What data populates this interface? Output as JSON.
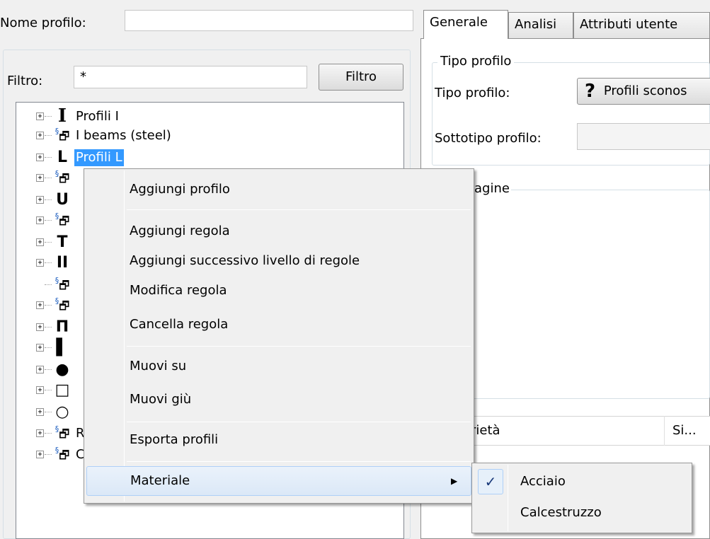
{
  "profile_name": {
    "label": "Nome profilo:",
    "value": ""
  },
  "filter": {
    "label": "Filtro:",
    "value": "*",
    "button": "Filtro"
  },
  "tree": {
    "items": [
      {
        "label": "Profili I",
        "icon": "i-beam-icon",
        "glyph": "I"
      },
      {
        "label": "I beams (steel)",
        "icon": "library-icon",
        "glyph": "§"
      },
      {
        "label": "Profili L",
        "icon": "l-profile-icon",
        "glyph": "L",
        "selected": true
      },
      {
        "label": "",
        "icon": "library-icon",
        "glyph": "§"
      },
      {
        "label": "",
        "icon": "u-profile-icon",
        "glyph": "U"
      },
      {
        "label": "",
        "icon": "library-icon",
        "glyph": "§"
      },
      {
        "label": "",
        "icon": "t-profile-icon",
        "glyph": "T"
      },
      {
        "label": "",
        "icon": "double-i-icon",
        "glyph": "II"
      },
      {
        "label": "",
        "icon": "library-icon",
        "glyph": "§"
      },
      {
        "label": "",
        "icon": "library-icon",
        "glyph": "§"
      },
      {
        "label": "",
        "icon": "hat-profile-icon",
        "glyph": "Π"
      },
      {
        "label": "",
        "icon": "flat-bar-icon",
        "glyph": "▌"
      },
      {
        "label": "",
        "icon": "round-bar-icon",
        "glyph": "●"
      },
      {
        "label": "",
        "icon": "rect-tube-icon",
        "glyph": "□"
      },
      {
        "label": "",
        "icon": "round-tube-icon",
        "glyph": "○"
      },
      {
        "label": "Ruukki",
        "icon": "library-icon",
        "glyph": "§"
      },
      {
        "label": "Crane rails",
        "icon": "library-icon",
        "glyph": "§"
      }
    ]
  },
  "tabs": [
    {
      "label": "Generale",
      "active": true
    },
    {
      "label": "Analisi",
      "active": false
    },
    {
      "label": "Attributi utente",
      "active": false
    }
  ],
  "profile_type_group": {
    "legend": "Tipo profilo",
    "type_label": "Tipo profilo:",
    "type_value": "Profili sconos",
    "type_icon": "question-icon",
    "subtype_label": "Sottotipo profilo:",
    "subtype_value": ""
  },
  "image_group": {
    "legend": "agine"
  },
  "properties_header": {
    "col1": "rietà",
    "col2": "Si..."
  },
  "context_menu": {
    "items": [
      {
        "label": "Aggiungi profilo"
      },
      {
        "label": "Aggiungi regola"
      },
      {
        "label": "Aggiungi successivo livello di regole"
      },
      {
        "label": "Modifica regola"
      },
      {
        "label": "Cancella regola"
      },
      {
        "label": "Muovi su"
      },
      {
        "label": "Muovi giù"
      },
      {
        "label": "Esporta profili"
      },
      {
        "label": "Materiale"
      }
    ],
    "submenu": [
      {
        "label": "Acciaio",
        "checked": true
      },
      {
        "label": "Calcestruzzo",
        "checked": false
      }
    ]
  }
}
